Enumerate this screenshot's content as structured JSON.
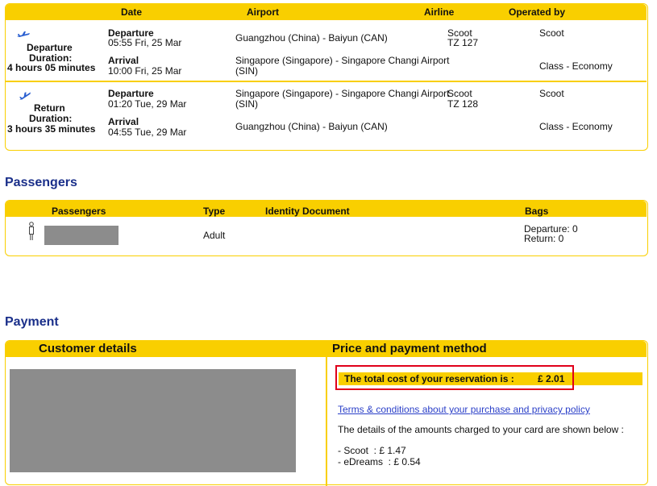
{
  "flights": {
    "headers": {
      "date": "Date",
      "airport": "Airport",
      "airline": "Airline",
      "operated": "Operated by"
    },
    "departure": {
      "icon": "plane-departure-icon",
      "label": "Departure",
      "duration_label": "Duration:",
      "duration": "4 hours 05 minutes",
      "leg1": {
        "kind": "Departure",
        "datetime": "05:55 Fri, 25 Mar",
        "airport": "Guangzhou (China) - Baiyun (CAN)",
        "airline": "Scoot",
        "flight": "TZ 127",
        "operated": "Scoot"
      },
      "leg2": {
        "kind": "Arrival",
        "datetime": "10:00 Fri, 25 Mar",
        "airport_line1": "Singapore (Singapore) - Singapore Changi Airport",
        "airport_line2": "(SIN)",
        "class": "Class - Economy"
      }
    },
    "return": {
      "icon": "plane-return-icon",
      "label": "Return",
      "duration_label": "Duration:",
      "duration": "3 hours 35 minutes",
      "leg1": {
        "kind": "Departure",
        "datetime": "01:20 Tue, 29 Mar",
        "airport_line1": "Singapore (Singapore) - Singapore Changi Airport",
        "airport_line2": "(SIN)",
        "airline": "Scoot",
        "flight": "TZ 128",
        "operated": "Scoot"
      },
      "leg2": {
        "kind": "Arrival",
        "datetime": "04:55 Tue, 29 Mar",
        "airport": "Guangzhou (China) - Baiyun (CAN)",
        "class": "Class - Economy"
      }
    }
  },
  "passengers": {
    "title": "Passengers",
    "headers": {
      "passengers": "Passengers",
      "type": "Type",
      "identity": "Identity Document",
      "bags": "Bags"
    },
    "row": {
      "type": "Adult",
      "bags_departure": "Departure: 0",
      "bags_return": "Return: 0"
    }
  },
  "payment": {
    "title": "Payment",
    "customer_header": "Customer details",
    "price_header": "Price and payment method",
    "total_label": "The total cost of your reservation is :",
    "total_value": "£ 2.01",
    "terms_link": "Terms & conditions about your purchase and privacy policy",
    "details_text": "The details of the amounts charged to your card are shown below :",
    "charges": [
      "- Scoot  : £ 1.47",
      "- eDreams  : £ 0.54"
    ]
  },
  "colors": {
    "accent": "#f9cf00",
    "title": "#1a2f8a",
    "highlight": "#e0001a",
    "link": "#2a3fc8"
  }
}
